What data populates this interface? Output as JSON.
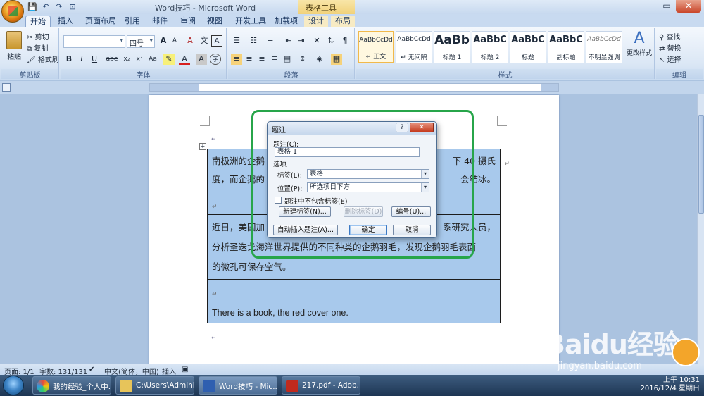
{
  "app": {
    "window_title": "Word技巧 - Microsoft Word",
    "context_tab_header": "表格工具",
    "win_controls": [
      "–",
      "▭",
      "✕"
    ]
  },
  "quick_access": [
    "💾",
    "↶",
    "↷",
    "⊡"
  ],
  "tabs": [
    "开始",
    "插入",
    "页面布局",
    "引用",
    "邮件",
    "审阅",
    "视图",
    "开发工具",
    "加载项",
    "设计",
    "布局"
  ],
  "ribbon": {
    "clipboard": {
      "paste": "粘贴",
      "cut": "剪切",
      "copy": "复制",
      "painter": "格式刷",
      "label": "剪贴板"
    },
    "font": {
      "font_name": "",
      "font_size": "四号",
      "label": "字体",
      "grow": "A",
      "shrink": "A",
      "clear": "A",
      "bold": "B",
      "italic": "I",
      "underline": "U",
      "strike": "abe",
      "sub": "x₂",
      "sup": "x²",
      "aa": "Aa",
      "color": "A",
      "wen": "文",
      "char_border": "A",
      "char_shade": "A",
      "enc": "字"
    },
    "paragraph": {
      "label": "段落"
    },
    "styles": {
      "label": "样式",
      "tiles": [
        {
          "sample": "AaBbCcDd",
          "name": "↵ 正文"
        },
        {
          "sample": "AaBbCcDd",
          "name": "↵ 无间隔"
        },
        {
          "sample": "AaBb",
          "name": "标题 1"
        },
        {
          "sample": "AaBbC",
          "name": "标题 2"
        },
        {
          "sample": "AaBbC",
          "name": "标题"
        },
        {
          "sample": "AaBbC",
          "name": "副标题"
        },
        {
          "sample": "AaBbCcDd",
          "name": "不明显强调"
        }
      ],
      "change_styles": "更改样式"
    },
    "editing": {
      "find": "查找",
      "replace": "替换",
      "select": "选择",
      "label": "编辑"
    }
  },
  "document": {
    "rows": [
      "南极洲的企鹅……在零下 40 摄氏度，而企鹅的……会结冰。",
      "",
      "近日，美国加……系研究人员，分析圣迭戈海洋世界提供的不同种类的企鹅羽毛，发现企鹅羽毛表面的微孔可保存空气。",
      "",
      "There is a book, the red cover one."
    ],
    "row_parts": {
      "r1a": "南极洲的企鹅",
      "r1b": "下 40 摄氏",
      "r1c": "度，而企鹅的",
      "r1d": "会结冰。",
      "r3a": "近日，美国加",
      "r3b": "系研究人员，",
      "r3c": "分析圣迭戈海洋世界提供的不同种类的企鹅羽毛，发现企鹅羽毛表面",
      "r3d": "的微孔可保存空气。",
      "r5": "There is a book, the red cover one."
    }
  },
  "dialog": {
    "title": "题注",
    "help": "?",
    "close": "✕",
    "caption_label": "题注(C):",
    "caption_value": "表格 1",
    "options_label": "选项",
    "tag_label": "标签(L):",
    "tag_value": "表格",
    "position_label": "位置(P):",
    "position_value": "所选项目下方",
    "exclude_label": "题注中不包含标签(E)",
    "exclude_checked": false,
    "new_label": "新建标签(N)...",
    "delete_label": "删除标签(D)",
    "numbering": "编号(U)...",
    "auto_insert": "自动插入题注(A)...",
    "ok": "确定",
    "cancel": "取消"
  },
  "statusbar": {
    "page": "页面: 1/1",
    "words": "字数: 131/131",
    "lang": "中文(简体，中国)",
    "mode": "插入"
  },
  "taskbar": {
    "items": [
      {
        "label": "我的经验_个人中...",
        "color": "#d64a3a"
      },
      {
        "label": "C:\\Users\\Admini...",
        "color": "#e7c45a"
      },
      {
        "label": "Word技巧 - Mic...",
        "color": "#2f5fb0"
      },
      {
        "label": "217.pdf - Adob...",
        "color": "#c02a1e"
      }
    ],
    "time": "上午 10:31",
    "date": "2016/12/4 星期日"
  },
  "watermark": {
    "brand": "Baidu经验",
    "url": "jingyan.baidu.com"
  }
}
